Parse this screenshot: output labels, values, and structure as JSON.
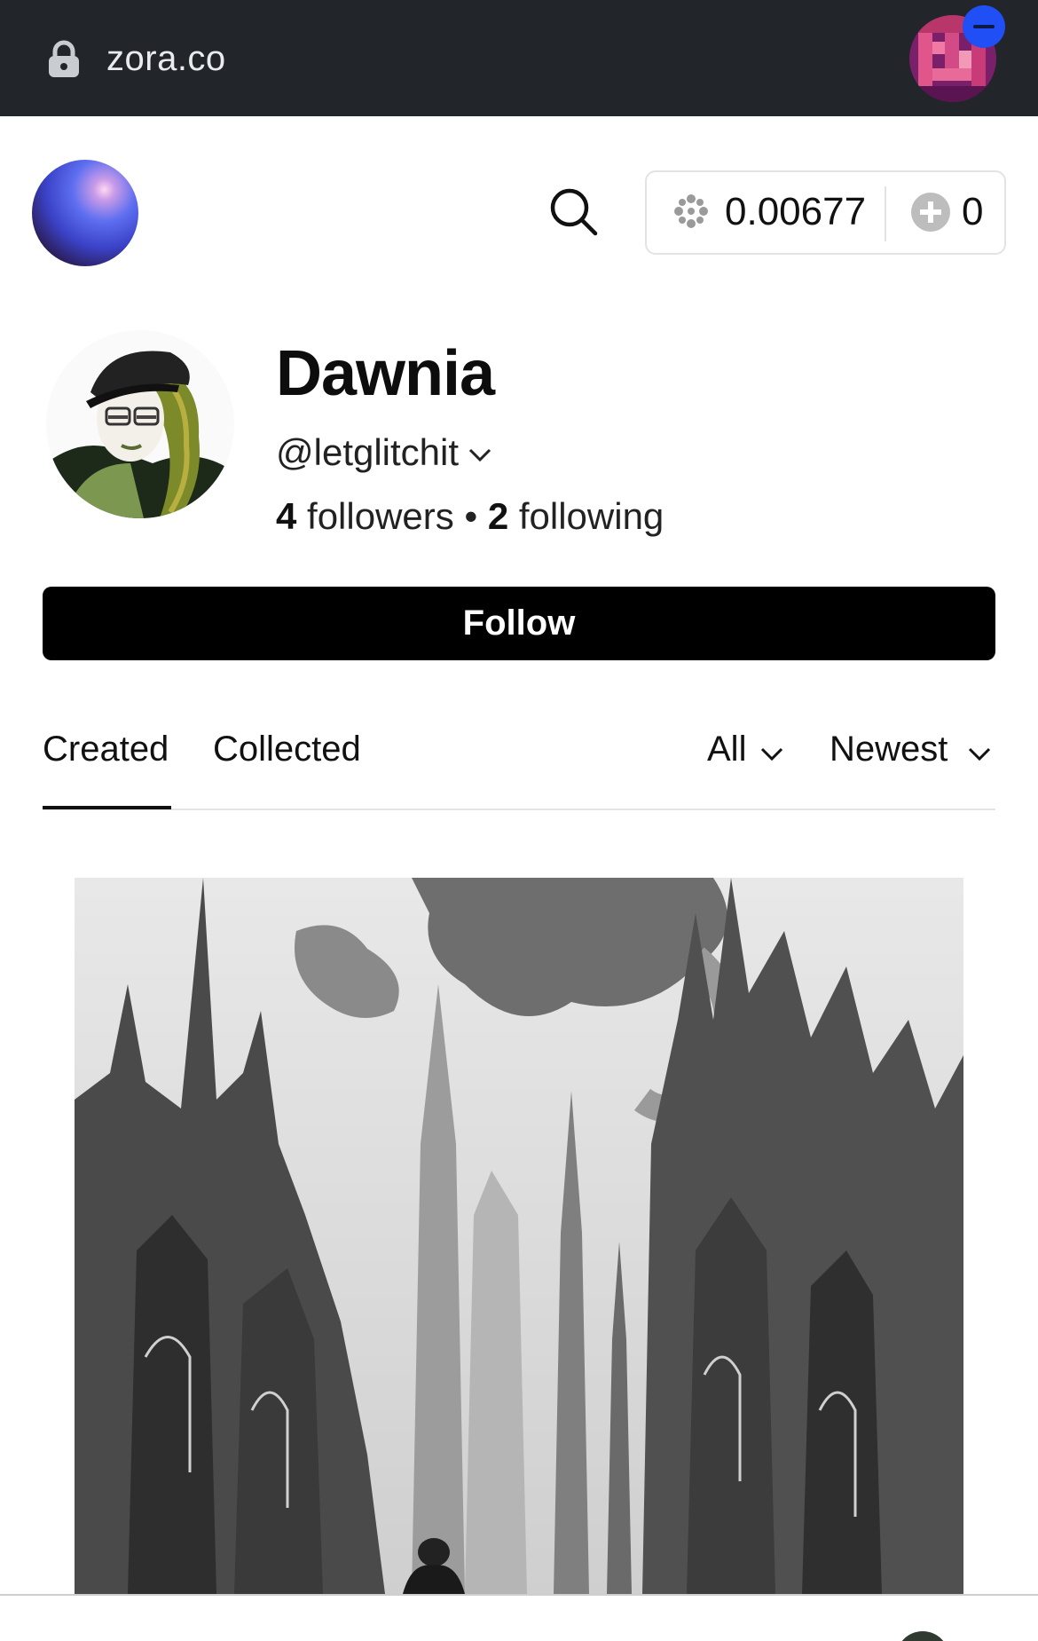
{
  "browser": {
    "url": "zora.co",
    "icons": {
      "lock": "lock-icon",
      "account": "account-avatar"
    },
    "badge_color": "#1f4ff5"
  },
  "header": {
    "icons": {
      "logo": "zora-orb-logo",
      "search": "search-icon",
      "eth": "eth-sparkle-icon",
      "plus": "plus-circle-icon"
    },
    "wallet": {
      "balance": "0.00677",
      "count": "0"
    }
  },
  "profile": {
    "name": "Dawnia",
    "handle": "@letglitchit",
    "followers_count": "4",
    "followers_label": "followers",
    "separator": "•",
    "following_count": "2",
    "following_label": "following",
    "follow_label": "Follow"
  },
  "tabs": {
    "items": [
      {
        "label": "Created",
        "active": true
      },
      {
        "label": "Collected",
        "active": false
      }
    ],
    "filter": "All",
    "sort": "Newest"
  },
  "colors": {
    "urlbar_bg": "#22262b",
    "primary_button": "#000000",
    "text": "#111111"
  }
}
